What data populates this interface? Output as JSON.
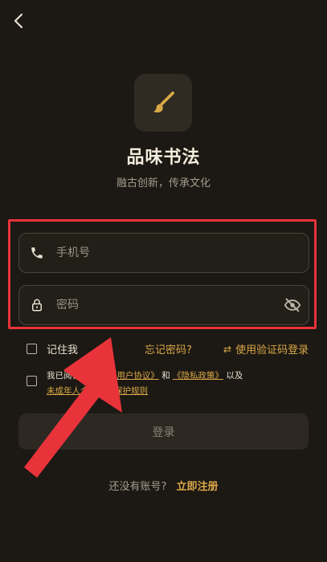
{
  "app": {
    "title": "品味书法",
    "subtitle": "融古创新，传承文化"
  },
  "form": {
    "phone_placeholder": "手机号",
    "password_placeholder": "密码"
  },
  "options": {
    "remember_label": "记住我",
    "forgot_label": "忘记密码?",
    "sms_login_label": "使用验证码登录"
  },
  "agreement": {
    "prefix": "我已阅读并同意",
    "user_agreement": "《用户协议》",
    "and": "和",
    "privacy_policy": "《隐私政策》",
    "also": "以及",
    "minor_policy": "未成年人个人信息保护规则"
  },
  "login_button": "登录",
  "register": {
    "question": "还没有账号?",
    "action": "立即注册"
  },
  "icons": {
    "back": "chevron-left-icon",
    "logo": "brush-icon",
    "phone": "phone-icon",
    "lock": "lock-icon",
    "eye": "eye-off-icon",
    "swap": "swap-icon"
  },
  "colors": {
    "background": "#1c1813",
    "accent": "#d9a848",
    "highlight": "#e8333b"
  }
}
